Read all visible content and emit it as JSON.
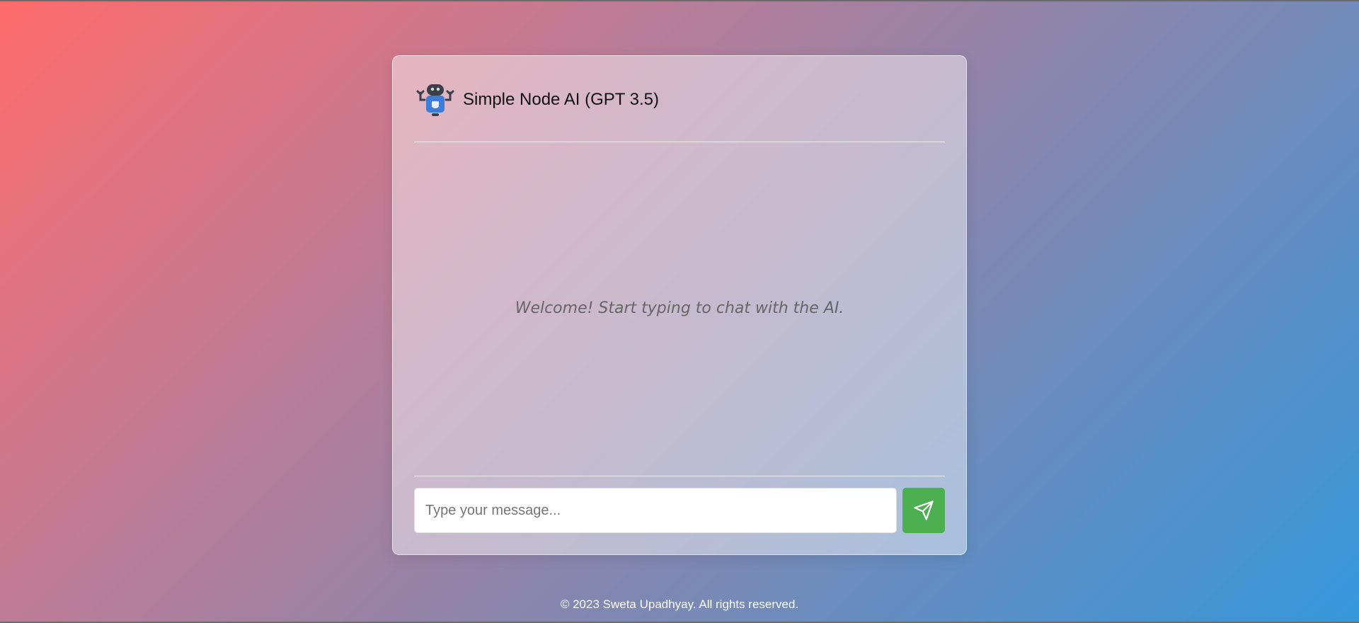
{
  "app": {
    "title": "Simple Node AI (GPT 3.5)",
    "logo_icon": "robot-icon"
  },
  "chat": {
    "welcome_message": "Welcome! Start typing to chat with the AI."
  },
  "input": {
    "placeholder": "Type your message...",
    "value": ""
  },
  "send_button": {
    "icon": "send-icon",
    "color": "#4caf50"
  },
  "footer": {
    "text": "© 2023 Sweta Upadhyay. All rights reserved."
  }
}
